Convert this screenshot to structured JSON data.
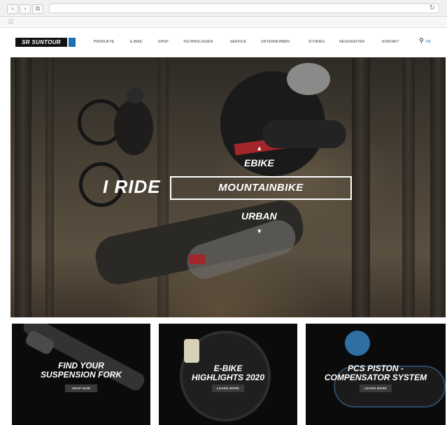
{
  "browser": {
    "nav_back": "‹",
    "nav_forward": "›",
    "nav_tabs": "⧉",
    "reload": "↻",
    "bookmarks": "☷"
  },
  "header": {
    "logo_text": "SR SUNTOUR",
    "menu": [
      "PRODUKTE",
      "E-BIKE",
      "SHOP",
      "TECHNOLOGIEN",
      "SERVICE",
      "UNTERNEHMEN",
      "STORIES",
      "NEUIGKEITEN",
      "KONTAKT"
    ],
    "lang": "DE"
  },
  "hero": {
    "prefix": "I RIDE",
    "selector": {
      "above": "EBIKE",
      "selected": "MOUNTAINBIKE",
      "below": "URBAN"
    },
    "arrow_up": "▲",
    "arrow_down": "▼"
  },
  "teasers": [
    {
      "title_1": "FIND YOUR",
      "title_2": "SUSPENSION FORK",
      "button": "SHOP NOW"
    },
    {
      "title_1": "E-BIKE",
      "title_2": "HIGHLIGHTS 2020",
      "button": "LEARN MORE"
    },
    {
      "title_1": "PCS PISTON -",
      "title_2": "COMPENSATOR SYSTEM",
      "button": "LEARN MORE"
    }
  ],
  "colors": {
    "brand_blue": "#1f6fb3",
    "accent_red": "#a3262a",
    "teaser_bg": "#0b0b0b"
  }
}
